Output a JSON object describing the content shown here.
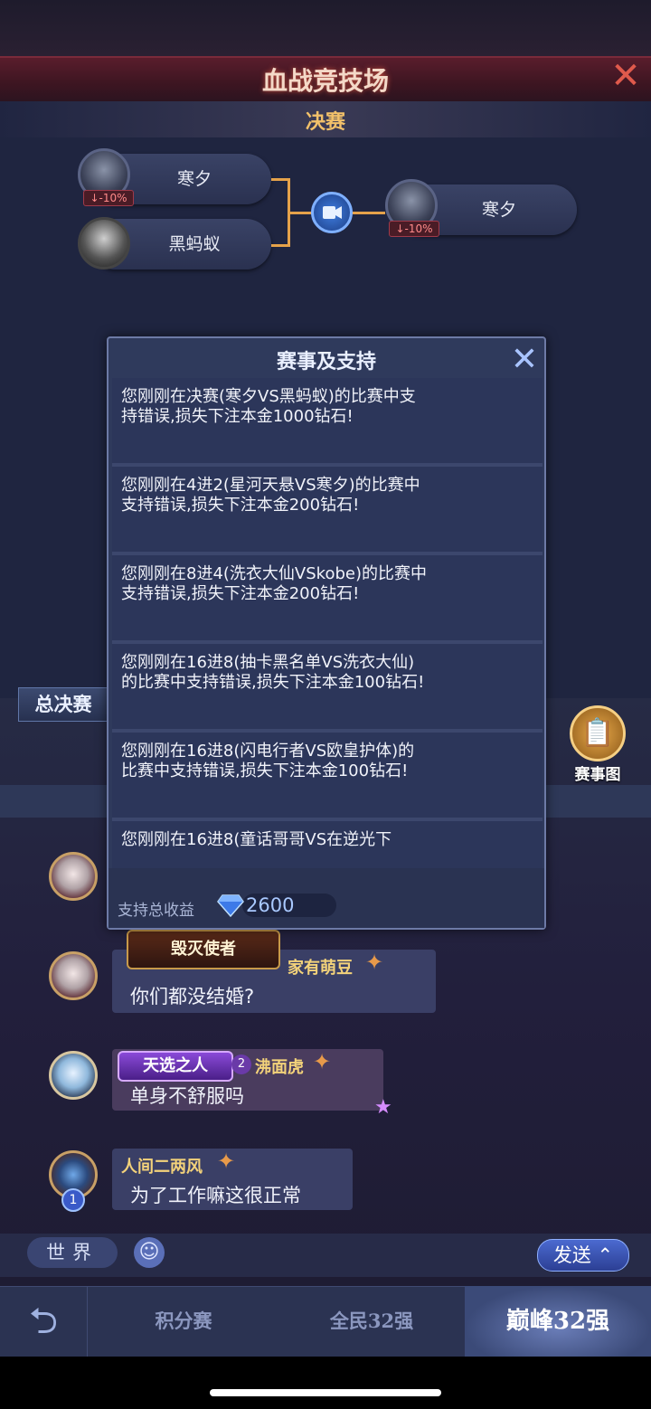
{
  "header": {
    "title": "血战竞技场",
    "close_icon": "close-icon",
    "round_title": "决赛"
  },
  "bracket": {
    "player1": {
      "name": "寒夕",
      "change": "↓-10%"
    },
    "player2": {
      "name": "黑蚂蚁"
    },
    "winner": {
      "name": "寒夕",
      "change": "↓-10%"
    },
    "replay_icon": "video-play-icon"
  },
  "tabs": {
    "final_tab": "总决赛",
    "schedule_label": "赛事图",
    "schedule_icon": "clipboard-icon"
  },
  "modal": {
    "title": "赛事及支持",
    "messages": [
      "您刚刚在决赛(寒夕VS黑蚂蚁)的比赛中支持错误,损失下注本金1000钻石!",
      "您刚刚在4进2(星河天悬VS寒夕)的比赛中支持错误,损失下注本金200钻石!",
      "您刚刚在8进4(洗衣大仙VSkobe)的比赛中支持错误,损失下注本金200钻石!",
      "您刚刚在16进8(抽卡黑名单VS洗衣大仙)的比赛中支持错误,损失下注本金100钻石!",
      "您刚刚在16进8(闪电行者VS欧皇护体)的比赛中支持错误,损失下注本金100钻石!",
      "您刚刚在16进8(童话哥哥VS在逆光下"
    ],
    "footer_label": "支持总收益",
    "footer_value": "2600",
    "footer_icon": "diamond-icon"
  },
  "chat": {
    "messages": [
      {
        "badge": "毁灭使者",
        "name": "家有萌豆",
        "text": "你们都没结婚?"
      },
      {
        "badge": "天选之人",
        "level": "2",
        "name": "沸面虎",
        "text": "单身不舒服吗"
      },
      {
        "vip": "1",
        "name": "人间二两风",
        "text": "为了工作嘛这很正常"
      }
    ]
  },
  "input": {
    "channel": "世界",
    "send": "发送"
  },
  "nav": {
    "items": [
      "积分赛",
      "全民32强",
      "巅峰32强"
    ],
    "active_index": 2
  },
  "colors": {
    "accent_gold": "#f2c16a",
    "header_red": "#5a1d2c",
    "loss_red": "#ff8a8a",
    "panel_blue": "#2f3a5c"
  }
}
